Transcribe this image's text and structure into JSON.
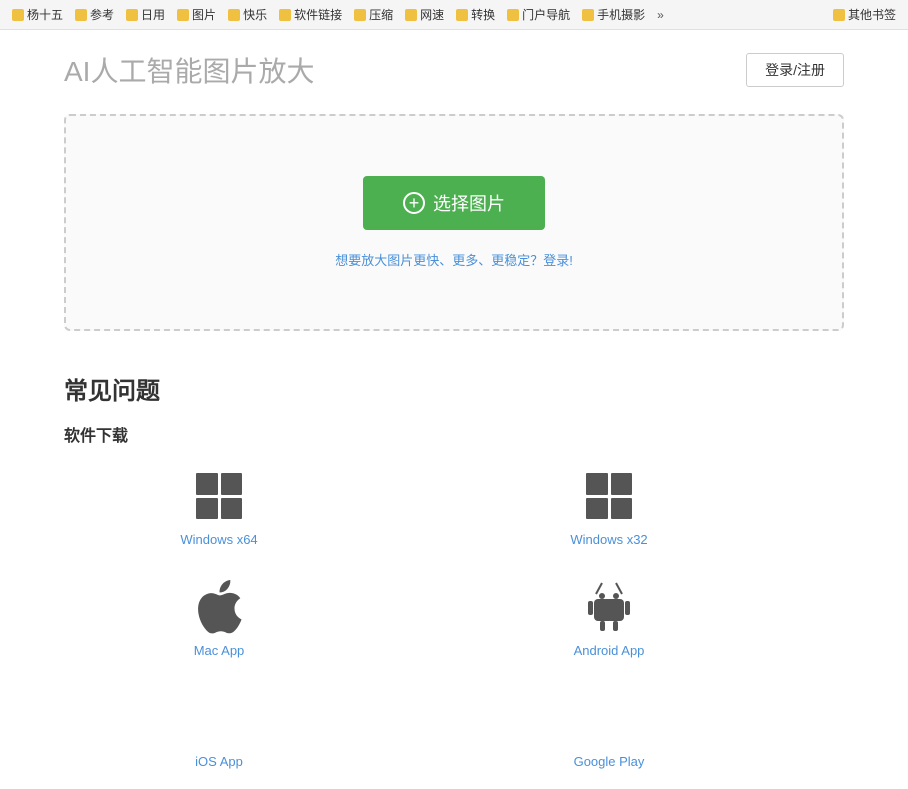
{
  "bookmarks": {
    "items": [
      {
        "label": "杨十五",
        "icon": "folder"
      },
      {
        "label": "参考",
        "icon": "folder"
      },
      {
        "label": "日用",
        "icon": "folder"
      },
      {
        "label": "图片",
        "icon": "folder"
      },
      {
        "label": "快乐",
        "icon": "folder"
      },
      {
        "label": "软件链接",
        "icon": "folder"
      },
      {
        "label": "压缩",
        "icon": "folder"
      },
      {
        "label": "网速",
        "icon": "folder"
      },
      {
        "label": "转换",
        "icon": "folder"
      },
      {
        "label": "门户导航",
        "icon": "folder"
      },
      {
        "label": "手机摄影",
        "icon": "folder"
      }
    ],
    "more_label": "»",
    "other_label": "其他书签",
    "other_icon": "folder"
  },
  "header": {
    "title": "AI人工智能图片放大",
    "login_label": "登录/注册"
  },
  "upload": {
    "select_btn_label": "选择图片",
    "hint_text": "想要放大图片更快、更多、更稳定？登录!"
  },
  "faq": {
    "title": "常见问题",
    "software_section": "软件下载",
    "downloads": [
      {
        "label": "Windows x64",
        "type": "windows",
        "col": 1
      },
      {
        "label": "Windows x32",
        "type": "windows",
        "col": 2
      },
      {
        "label": "Mac App",
        "type": "apple",
        "col": 1
      },
      {
        "label": "Android App",
        "type": "android",
        "col": 2
      },
      {
        "label": "iOS App",
        "type": "ios",
        "col": 1
      },
      {
        "label": "Google Play",
        "type": "googleplay",
        "col": 2
      }
    ]
  }
}
